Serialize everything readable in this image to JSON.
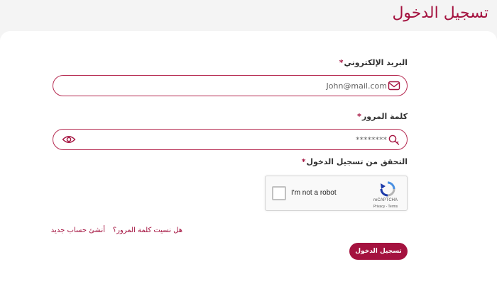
{
  "header": {
    "title": "تسجيل الدخول"
  },
  "form": {
    "email": {
      "label": "البريد الإلكتروني",
      "required_mark": "*",
      "value": "John@mail.com",
      "icon": "envelope-icon"
    },
    "password": {
      "label": "كلمة المرور",
      "required_mark": "*",
      "value": "********",
      "icon": "key-icon",
      "toggle_icon": "eye-icon"
    },
    "captcha": {
      "label": "التحقق من تسجيل الدخول",
      "required_mark": "*",
      "checkbox_text": "I'm not a robot",
      "brand": "reCAPTCHA",
      "terms": "Privacy - Terms",
      "checked": false
    },
    "links": {
      "forgot_password": "هل نسيت كلمة المرور؟",
      "create_account": "أنشئ حساب جديد"
    },
    "submit_label": "تسجيل الدخول"
  },
  "colors": {
    "brand": "#a4123f",
    "background": "#f4f4f4",
    "card": "#ffffff"
  }
}
